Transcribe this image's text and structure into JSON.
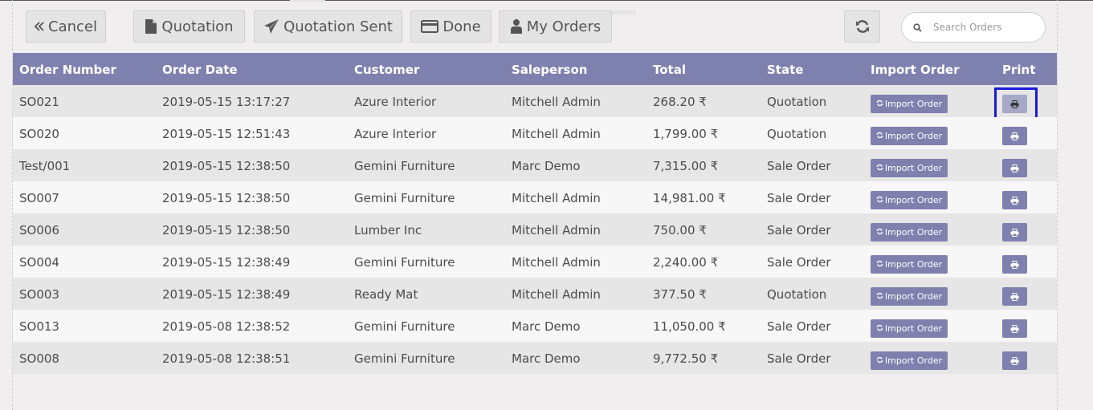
{
  "toolbar": {
    "cancel_label": "Cancel",
    "quotation_label": "Quotation",
    "quotation_sent_label": "Quotation Sent",
    "done_label": "Done",
    "my_orders_label": "My Orders",
    "search_placeholder": "Search Orders"
  },
  "table": {
    "headers": {
      "order_number": "Order Number",
      "order_date": "Order Date",
      "customer": "Customer",
      "saleperson": "Saleperson",
      "total": "Total",
      "state": "State",
      "import_order": "Import Order",
      "print": "Print"
    },
    "import_label": "Import Order",
    "rows": [
      {
        "number": "SO021",
        "date": "2019-05-15 13:17:27",
        "customer": "Azure Interior",
        "saleperson": "Mitchell Admin",
        "total": "268.20 ₹",
        "state": "Quotation"
      },
      {
        "number": "SO020",
        "date": "2019-05-15 12:51:43",
        "customer": "Azure Interior",
        "saleperson": "Mitchell Admin",
        "total": "1,799.00 ₹",
        "state": "Quotation"
      },
      {
        "number": "Test/001",
        "date": "2019-05-15 12:38:50",
        "customer": "Gemini Furniture",
        "saleperson": "Marc Demo",
        "total": "7,315.00 ₹",
        "state": "Sale Order"
      },
      {
        "number": "SO007",
        "date": "2019-05-15 12:38:50",
        "customer": "Gemini Furniture",
        "saleperson": "Mitchell Admin",
        "total": "14,981.00 ₹",
        "state": "Sale Order"
      },
      {
        "number": "SO006",
        "date": "2019-05-15 12:38:50",
        "customer": "Lumber Inc",
        "saleperson": "Mitchell Admin",
        "total": "750.00 ₹",
        "state": "Sale Order"
      },
      {
        "number": "SO004",
        "date": "2019-05-15 12:38:49",
        "customer": "Gemini Furniture",
        "saleperson": "Mitchell Admin",
        "total": "2,240.00 ₹",
        "state": "Sale Order"
      },
      {
        "number": "SO003",
        "date": "2019-05-15 12:38:49",
        "customer": "Ready Mat",
        "saleperson": "Mitchell Admin",
        "total": "377.50 ₹",
        "state": "Quotation"
      },
      {
        "number": "SO013",
        "date": "2019-05-08 12:38:52",
        "customer": "Gemini Furniture",
        "saleperson": "Marc Demo",
        "total": "11,050.00 ₹",
        "state": "Sale Order"
      },
      {
        "number": "SO008",
        "date": "2019-05-08 12:38:51",
        "customer": "Gemini Furniture",
        "saleperson": "Marc Demo",
        "total": "9,772.50 ₹",
        "state": "Sale Order"
      }
    ]
  },
  "colors": {
    "header_bg": "#7e81ae",
    "highlight_border": "#1a1ad6"
  },
  "icons": {
    "cancel": "double-chevron-left-icon",
    "quotation": "file-icon",
    "quotation_sent": "paper-plane-icon",
    "done": "credit-card-icon",
    "my_orders": "user-icon",
    "refresh": "refresh-icon",
    "search": "search-icon",
    "import": "refresh-icon",
    "print": "printer-icon"
  }
}
